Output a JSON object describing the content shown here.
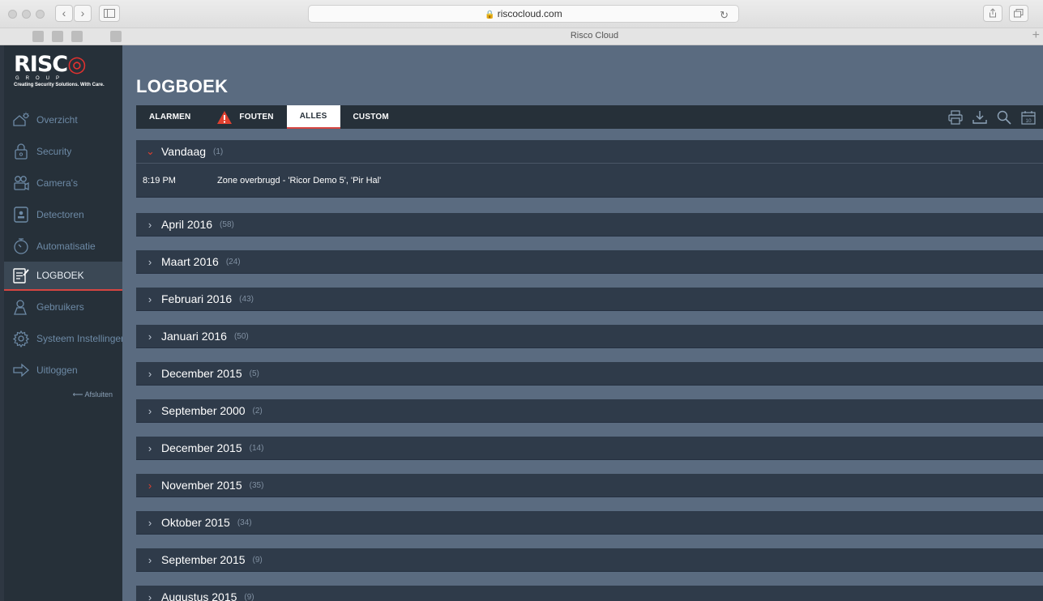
{
  "browser": {
    "url": "riscocloud.com",
    "tab_title": "Risco Cloud",
    "back_label": "‹",
    "forward_label": "›"
  },
  "logo": {
    "brand": "RISC",
    "group": "GROUP",
    "tagline": "Creating Security Solutions. With Care."
  },
  "sidebar": {
    "items": [
      {
        "label": "Overzicht",
        "icon": "home-sun-icon"
      },
      {
        "label": "Security",
        "icon": "lock-icon"
      },
      {
        "label": "Camera's",
        "icon": "camera-icon"
      },
      {
        "label": "Detectoren",
        "icon": "detector-icon"
      },
      {
        "label": "Automatisatie",
        "icon": "timer-icon"
      },
      {
        "label": "LOGBOEK",
        "icon": "logbook-icon"
      },
      {
        "label": "Gebruikers",
        "icon": "user-icon"
      },
      {
        "label": "Systeem Instellingen",
        "icon": "gear-icon"
      },
      {
        "label": "Uitloggen",
        "icon": "logout-arrow-icon"
      }
    ],
    "close_label": "⟵ Afsluiten"
  },
  "page": {
    "title": "LOGBOEK"
  },
  "tabs": [
    {
      "label": "ALARMEN"
    },
    {
      "label": "FOUTEN"
    },
    {
      "label": "ALLES"
    },
    {
      "label": "CUSTOM"
    }
  ],
  "tools": [
    "printer-icon",
    "download-icon",
    "search-icon",
    "calendar-icon"
  ],
  "calendar_day": "10",
  "today": {
    "label": "Vandaag",
    "count": "(1)",
    "events": [
      {
        "time": "8:19 PM",
        "text": "Zone overbrugd - 'Ricor Demo 5', 'Pir Hal'"
      }
    ]
  },
  "months": [
    {
      "label": "April 2016",
      "count": "(58)"
    },
    {
      "label": "Maart 2016",
      "count": "(24)"
    },
    {
      "label": "Februari 2016",
      "count": "(43)"
    },
    {
      "label": "Januari 2016",
      "count": "(50)"
    },
    {
      "label": "December 2015",
      "count": "(5)"
    },
    {
      "label": "September 2000",
      "count": "(2)"
    },
    {
      "label": "December 2015",
      "count": "(14)"
    },
    {
      "label": "November 2015",
      "count": "(35)"
    },
    {
      "label": "Oktober 2015",
      "count": "(34)"
    },
    {
      "label": "September 2015",
      "count": "(9)"
    },
    {
      "label": "Augustus 2015",
      "count": "(9)"
    }
  ],
  "colors": {
    "accent": "#d64541",
    "sidebar_bg": "#263039",
    "content_bg": "#5a6b80",
    "section_bg": "#2f3b4a"
  }
}
